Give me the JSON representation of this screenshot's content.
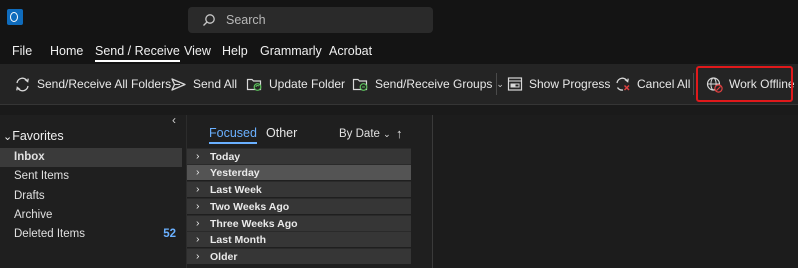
{
  "search": {
    "placeholder": "Search"
  },
  "menu": {
    "items": [
      "File",
      "Home",
      "Send / Receive",
      "View",
      "Help",
      "Grammarly",
      "Acrobat"
    ],
    "active": "Send / Receive"
  },
  "ribbon": {
    "send_receive_all": "Send/Receive All Folders",
    "send_all": "Send All",
    "update_folder": "Update Folder",
    "send_receive_groups": "Send/Receive Groups",
    "show_progress": "Show Progress",
    "cancel_all": "Cancel All",
    "work_offline": "Work Offline"
  },
  "sidebar": {
    "section_title": "Favorites",
    "folders": [
      {
        "label": "Inbox",
        "count": ""
      },
      {
        "label": "Sent Items",
        "count": ""
      },
      {
        "label": "Drafts",
        "count": ""
      },
      {
        "label": "Archive",
        "count": ""
      },
      {
        "label": "Deleted Items",
        "count": "52"
      }
    ]
  },
  "message_list": {
    "tabs": [
      "Focused",
      "Other"
    ],
    "sort_label": "By Date",
    "groups": [
      "Today",
      "Yesterday",
      "Last Week",
      "Two Weeks Ago",
      "Three Weeks Ago",
      "Last Month",
      "Older"
    ]
  },
  "colors": {
    "accent": "#6ab0ff",
    "highlight_border": "#e0191b",
    "brand": "#0f6cbd"
  }
}
